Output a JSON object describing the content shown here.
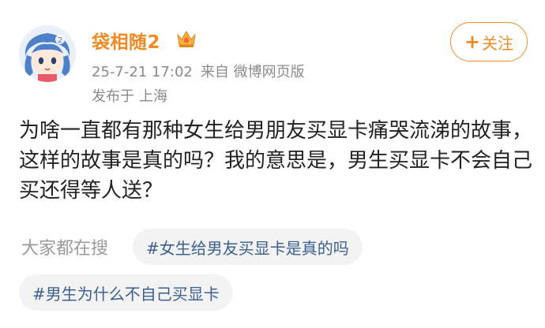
{
  "user": {
    "name": "袋相随2",
    "avatar_icon": "anime-girl-avatar",
    "vip_icon": "crown-vip-icon"
  },
  "meta": {
    "datetime": "25-7-21 17:02",
    "source": "来自 微博网页版",
    "location_prefix": "发布于",
    "location": "上海"
  },
  "follow_button": {
    "plus": "+",
    "label": "关注"
  },
  "post": {
    "text": "为啥一直都有那种女生给男朋友买显卡痛哭流涕的故事，这样的故事是真的吗？我的意思是，男生买显卡不会自己买还得等人送？"
  },
  "search": {
    "label": "大家都在搜",
    "tags": [
      "#女生给男友买显卡是真的吗",
      "#男生为什么不自己买显卡"
    ]
  },
  "colors": {
    "accent": "#f08a24",
    "link": "#3c5f91",
    "muted": "#8a8a8a"
  }
}
